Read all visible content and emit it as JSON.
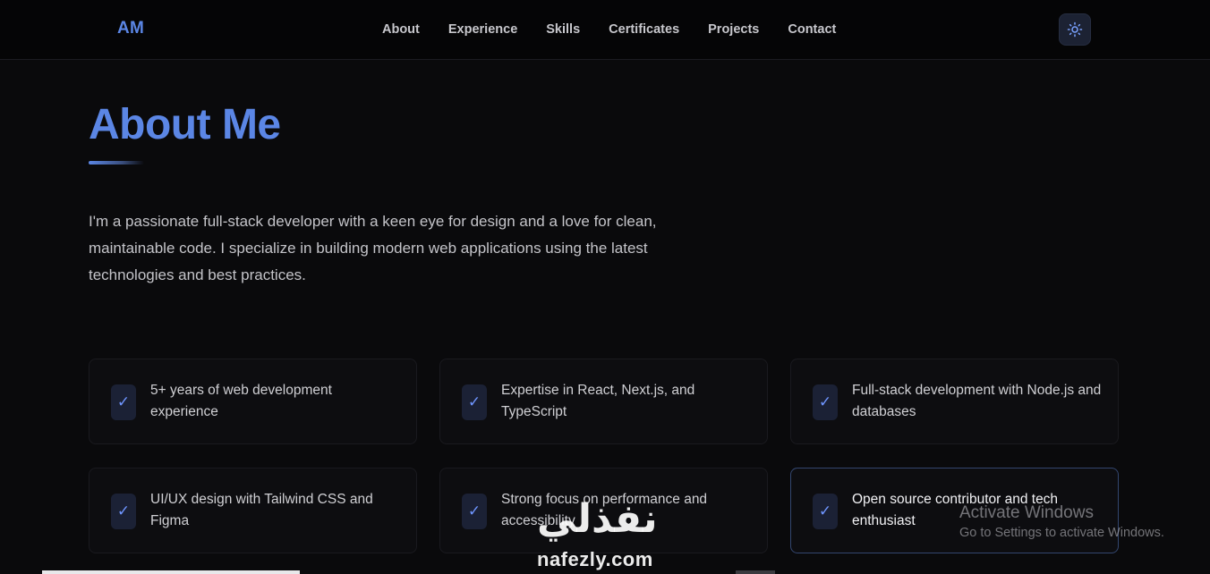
{
  "nav": {
    "logo": "AM",
    "links": [
      "About",
      "Experience",
      "Skills",
      "Certificates",
      "Projects",
      "Contact"
    ],
    "theme_icon": "sun-icon"
  },
  "about": {
    "title": "About Me",
    "intro": "I'm a passionate full-stack developer with a keen eye for design and a love for clean, maintainable code. I specialize in building modern web applications using the latest technologies and best practices."
  },
  "highlights": [
    {
      "check": "✓",
      "text": "5+ years of web development experience"
    },
    {
      "check": "✓",
      "text": "Expertise in React, Next.js, and TypeScript"
    },
    {
      "check": "✓",
      "text": "Full-stack development with Node.js and databases"
    },
    {
      "check": "✓",
      "text": "UI/UX design with Tailwind CSS and Figma"
    },
    {
      "check": "✓",
      "text": "Strong focus on performance and accessibility"
    },
    {
      "check": "✓",
      "text": "Open source contributor and tech enthusiast"
    }
  ],
  "overlay": {
    "windows_title": "Activate Windows",
    "windows_sub": "Go to Settings to activate Windows.",
    "logo_arabic": "نفذلي",
    "logo_latin": "nafezly.com"
  },
  "colors": {
    "accent": "#5b86e5",
    "background": "#0a0a0c"
  }
}
